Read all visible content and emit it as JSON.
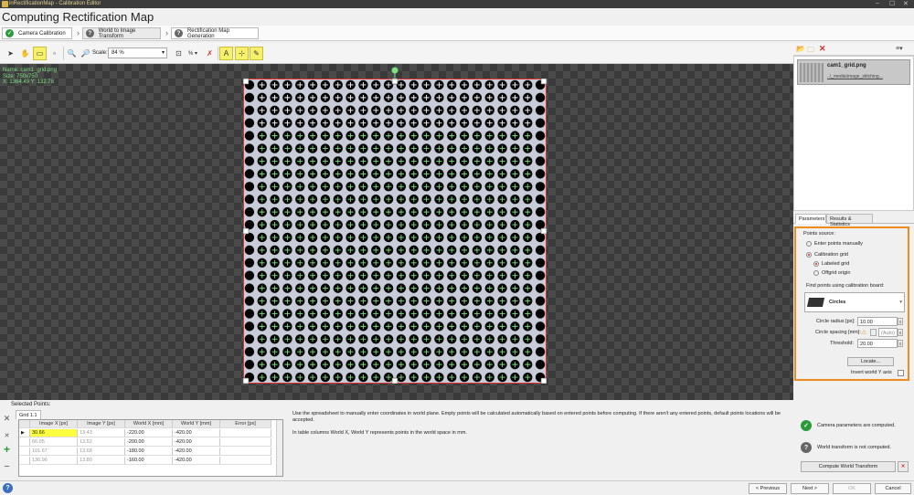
{
  "window": {
    "title": "inRectificationMap - Calibration Editor",
    "controls": [
      "‒",
      "☐",
      "✕"
    ]
  },
  "page_title": "Computing Rectification Map",
  "steps": [
    {
      "label": "Camera Calibration",
      "status": "done"
    },
    {
      "label": "World to Image Transform",
      "status": "pending"
    },
    {
      "label": "Rectification Map Generation",
      "status": "pending"
    }
  ],
  "toolbar": {
    "scale_label": "Scale:",
    "scale_value": "84 %",
    "zoom_suffix": "% ▾"
  },
  "image_info": {
    "name": "Name: cam1_grid.png",
    "size": "Size: 750x750",
    "coords": "X: 1364.49 Y: 132.78"
  },
  "file_list": {
    "items": [
      {
        "name": "cam1_grid.png",
        "path": "..\\_media\\image_stitching..."
      }
    ]
  },
  "panel_tabs": [
    "Parameters",
    "Results & Statistics"
  ],
  "parameters": {
    "points_source_label": "Points source:",
    "opt_manual": "Enter points manually",
    "opt_calib_grid": "Calibration grid",
    "opt_labeled": "Labeled grid",
    "opt_offgrid": "Offgrid origin",
    "find_points_label": "Find points using calibration board:",
    "board_type": "Circles",
    "circle_radius_label": "Circle radius [px]:",
    "circle_radius_value": "10.00",
    "circle_spacing_label": "Circle spacing [mm]:",
    "circle_spacing_value": "(Auto)",
    "threshold_label": "Threshold:",
    "threshold_value": "20.00",
    "locate_button": "Locate...",
    "invert_y_label": "Invert world Y axis"
  },
  "selected_points": {
    "label": "Selected Points:",
    "tab": "Grid 1.1",
    "columns": [
      "Image X [px]",
      "Image Y [px]",
      "World X [mm]",
      "World Y [mm]",
      "Error [px]"
    ],
    "rows": [
      [
        "30.66",
        "13.43",
        "-220.00",
        "-420.00",
        ""
      ],
      [
        "66.05",
        "13.52",
        "-200.00",
        "-420.00",
        ""
      ],
      [
        "101.67",
        "13.68",
        "-180.00",
        "-420.00",
        ""
      ],
      [
        "136.96",
        "13.80",
        "-160.00",
        "-420.00",
        ""
      ]
    ]
  },
  "help_text": [
    "Use the spreadsheet to manually enter coordinates in world plane. Empty points will be calculated automatically based on entered points before computing. If there aren't any entered points, default points locations will be accepted.",
    "In table columns World X, World Y represents points in the world space in mm."
  ],
  "status": {
    "camera": "Camera parameters are computed.",
    "world": "World transform is not computed.",
    "compute_button": "Compute World Transform"
  },
  "nav": {
    "previous": "< Previous",
    "next": "Next >",
    "ok": "OK",
    "cancel": "Cancel"
  },
  "colors": {
    "accent_orange": "#ef8a1f",
    "done_green": "#2a9a3a",
    "highlight_yellow": "#ffff40"
  }
}
